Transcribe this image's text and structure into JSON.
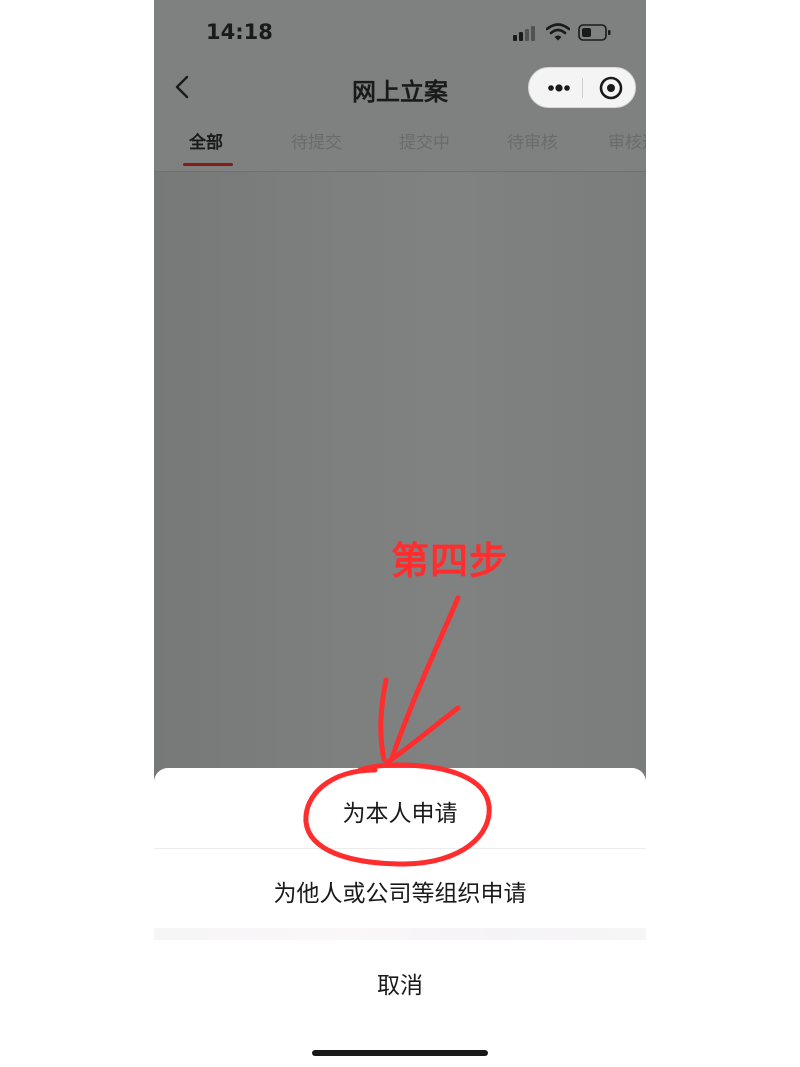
{
  "status_bar": {
    "time": "14:18"
  },
  "nav": {
    "title": "网上立案"
  },
  "tabs": [
    {
      "label": "全部"
    },
    {
      "label": "待提交"
    },
    {
      "label": "提交中"
    },
    {
      "label": "待审核"
    },
    {
      "label": "审核通过"
    }
  ],
  "annotation": {
    "label": "第四步",
    "color": "#ff2d2d"
  },
  "action_sheet": {
    "self_apply": "为本人申请",
    "other_apply": "为他人或公司等组织申请",
    "cancel": "取消"
  },
  "colors": {
    "tab_indicator": "#8b1a1a",
    "overlay": "#7f8181"
  },
  "icons": {
    "back": "chevron-left-icon",
    "more": "more-dots-icon",
    "close": "target-circle-icon",
    "signal": "cellular-signal-icon",
    "wifi": "wifi-icon",
    "battery": "battery-icon"
  }
}
